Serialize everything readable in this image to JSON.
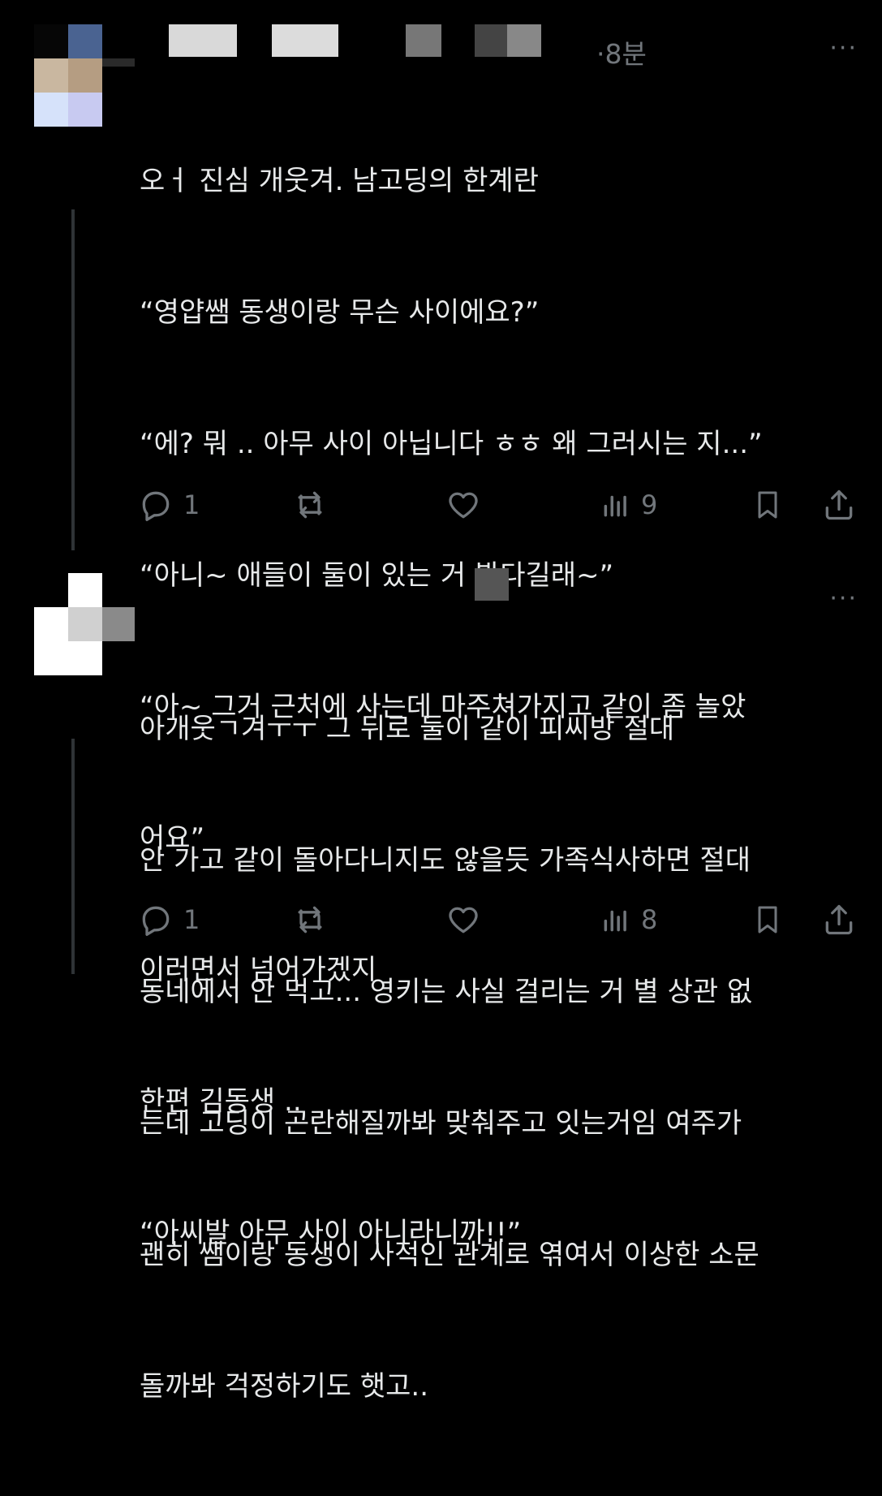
{
  "colors": {
    "background": "#000000",
    "text": "#e7e9ea",
    "muted": "#71767b",
    "thread_line": "#2f3336"
  },
  "posts": [
    {
      "time": "·8분",
      "more": "···",
      "lines": [
        "오ㅓ 진심 개웃겨. 남고딩의 한계란",
        "“영얍쌤 동생이랑 무슨 사이에요?”",
        "“에? 뭐 .. 아무 사이 아닙니다 ㅎㅎ 왜 그러시는 지...”",
        "“아니~ 애들이 둘이 있는 거 봤다길래~”",
        "“아~ 그거 근처에 사는데 마주쳐가지고 같이 좀 놀았",
        "어요”",
        "이러면서 넘어가겠지",
        "한편 김동생 ..",
        "“아씨발 아무 사이 아니라니까!!”"
      ],
      "actions": {
        "reply_icon": "reply-icon",
        "reply_count": "1",
        "repost_icon": "repost-icon",
        "like_icon": "heart-icon",
        "views_icon": "views-icon",
        "views_count": "9",
        "bookmark_icon": "bookmark-icon",
        "share_icon": "share-icon"
      }
    },
    {
      "time": "",
      "more": "···",
      "lines": [
        "아개웃ㄱ겨ㅜㅜ 그 뒤로 둘이 같이 피씨방 절대",
        "안 가고 같이 돌아다니지도 않을듯 가족식사하면 절대",
        "동네에서 안 먹고... 영키는 사실 걸리는 거 별 상관 없",
        "는데 고딩이 곤란해질까봐 맞춰주고 잇는거임 여주가",
        "괜히 쌤이랑 동생이 사적인 관계로 엮여서 이상한 소문",
        "돌까봐 걱정하기도 햇고.."
      ],
      "actions": {
        "reply_icon": "reply-icon",
        "reply_count": "1",
        "repost_icon": "repost-icon",
        "like_icon": "heart-icon",
        "views_icon": "views-icon",
        "views_count": "8",
        "bookmark_icon": "bookmark-icon",
        "share_icon": "share-icon"
      }
    }
  ]
}
